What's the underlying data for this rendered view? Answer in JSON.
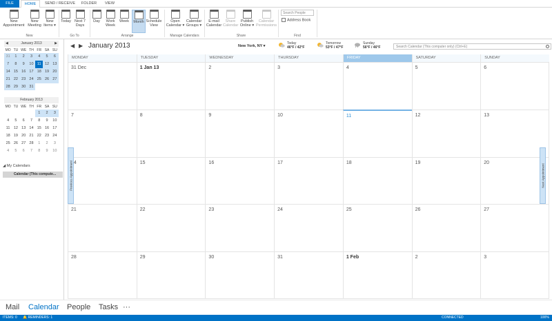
{
  "tabs": [
    "FILE",
    "HOME",
    "SEND / RECEIVE",
    "FOLDER",
    "VIEW"
  ],
  "ribbon": {
    "new_appointment": [
      "New",
      "Appointment"
    ],
    "new_meeting": [
      "New",
      "Meeting"
    ],
    "new_items": [
      "New",
      "Items ▾"
    ],
    "today": "Today",
    "next7": [
      "Next 7",
      "Days"
    ],
    "day": "Day",
    "work_week": [
      "Work",
      "Week"
    ],
    "week": "Week",
    "month": "Month",
    "schedule_view": [
      "Schedule",
      "View"
    ],
    "open_calendar": [
      "Open",
      "Calendar ▾"
    ],
    "calendar_groups": [
      "Calendar",
      "Groups ▾"
    ],
    "email_calendar": [
      "E-mail",
      "Calendar"
    ],
    "share_calendar": [
      "Share",
      "Calendar"
    ],
    "publish_online": [
      "Publish",
      "Online ▾"
    ],
    "calendar_permissions": [
      "Calendar",
      "Permissions"
    ],
    "search_people": "Search People",
    "address_book": "Address Book",
    "groups": [
      "New",
      "Go To",
      "Arrange",
      "Manage Calendars",
      "Share",
      "Find"
    ]
  },
  "mini_jan": {
    "title": "January 2013",
    "days": [
      "MO",
      "TU",
      "WE",
      "TH",
      "FR",
      "SA",
      "SU"
    ],
    "weeks": [
      [
        "31",
        "1",
        "2",
        "3",
        "4",
        "5",
        "6"
      ],
      [
        "7",
        "8",
        "9",
        "10",
        "11",
        "12",
        "13"
      ],
      [
        "14",
        "15",
        "16",
        "17",
        "18",
        "19",
        "20"
      ],
      [
        "21",
        "22",
        "23",
        "24",
        "25",
        "26",
        "27"
      ],
      [
        "28",
        "29",
        "30",
        "31",
        "",
        "",
        ""
      ]
    ]
  },
  "mini_feb": {
    "title": "February 2013",
    "days": [
      "MO",
      "TU",
      "WE",
      "TH",
      "FR",
      "SA",
      "SU"
    ],
    "weeks": [
      [
        "",
        "",
        "",
        "",
        "1",
        "2",
        "3"
      ],
      [
        "4",
        "5",
        "6",
        "7",
        "8",
        "9",
        "10"
      ],
      [
        "11",
        "12",
        "13",
        "14",
        "15",
        "16",
        "17"
      ],
      [
        "18",
        "19",
        "20",
        "21",
        "22",
        "23",
        "24"
      ],
      [
        "25",
        "26",
        "27",
        "28",
        "1",
        "2",
        "3"
      ],
      [
        "4",
        "5",
        "6",
        "7",
        "8",
        "9",
        "10"
      ]
    ]
  },
  "my_calendars": "◢ My Calendars",
  "calendar_item": "Calendar (This compute...",
  "header": {
    "month_title": "January 2013",
    "location": "New York, NY ▾",
    "weather": [
      {
        "label": "Today",
        "temp": "46°F / 42°F"
      },
      {
        "label": "Tomorrow",
        "temp": "53°F / 47°F"
      },
      {
        "label": "Sunday",
        "temp": "56°F / 46°F"
      }
    ],
    "search_placeholder": "Search Calendar (This computer only) (Ctrl+E)"
  },
  "weekdays": [
    "MONDAY",
    "TUESDAY",
    "WEDNESDAY",
    "THURSDAY",
    "FRIDAY",
    "SATURDAY",
    "SUNDAY"
  ],
  "weeks": [
    [
      "31 Dec",
      "1 Jan 13",
      "2",
      "3",
      "4",
      "5",
      "6"
    ],
    [
      "7",
      "8",
      "9",
      "10",
      "11",
      "12",
      "13"
    ],
    [
      "14",
      "15",
      "16",
      "17",
      "18",
      "19",
      "20"
    ],
    [
      "21",
      "22",
      "23",
      "24",
      "25",
      "26",
      "27"
    ],
    [
      "28",
      "29",
      "30",
      "31",
      "1 Feb",
      "2",
      "3"
    ]
  ],
  "previous_appointment": "Previous Appointment",
  "next_appointment": "Next Appointment",
  "bottom_nav": [
    "Mail",
    "Calendar",
    "People",
    "Tasks",
    "···"
  ],
  "status": {
    "items": "ITEMS: 0",
    "reminders": "🔔 REMINDERS: 1",
    "connected": "CONNECTED",
    "zoom": "100%"
  },
  "colors": {
    "accent": "#0072c6",
    "today_cell": "#cde3f6"
  }
}
